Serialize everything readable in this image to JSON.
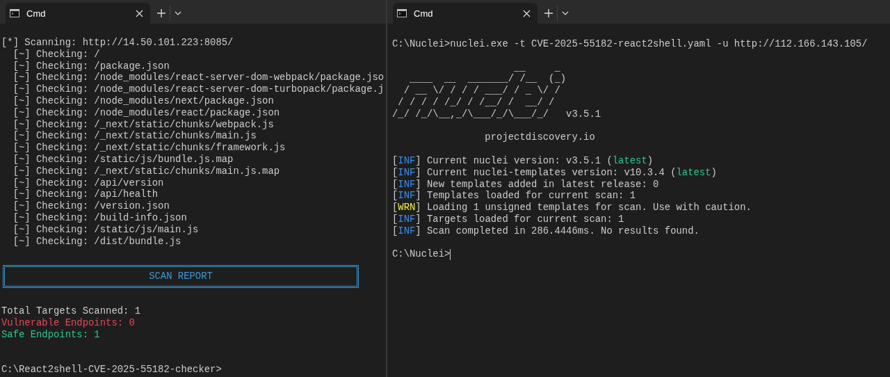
{
  "windows": [
    {
      "tab": {
        "title": "Cmd",
        "selected": true
      },
      "lines": [
        {
          "kind": "text",
          "segments": [
            {
              "text": "[*] Scanning: http://14.50.101.223:8085/"
            }
          ]
        },
        {
          "kind": "text",
          "segments": [
            {
              "text": "  [~] Checking: /"
            }
          ]
        },
        {
          "kind": "text",
          "segments": [
            {
              "text": "  [~] Checking: /package.json"
            }
          ]
        },
        {
          "kind": "text",
          "segments": [
            {
              "text": "  [~] Checking: /node_modules/react-server-dom-webpack/package.jso"
            }
          ]
        },
        {
          "kind": "text",
          "segments": [
            {
              "text": "  [~] Checking: /node_modules/react-server-dom-turbopack/package.j"
            }
          ]
        },
        {
          "kind": "text",
          "segments": [
            {
              "text": "  [~] Checking: /node_modules/next/package.json"
            }
          ]
        },
        {
          "kind": "text",
          "segments": [
            {
              "text": "  [~] Checking: /node_modules/react/package.json"
            }
          ]
        },
        {
          "kind": "text",
          "segments": [
            {
              "text": "  [~] Checking: /_next/static/chunks/webpack.js"
            }
          ]
        },
        {
          "kind": "text",
          "segments": [
            {
              "text": "  [~] Checking: /_next/static/chunks/main.js"
            }
          ]
        },
        {
          "kind": "text",
          "segments": [
            {
              "text": "  [~] Checking: /_next/static/chunks/framework.js"
            }
          ]
        },
        {
          "kind": "text",
          "segments": [
            {
              "text": "  [~] Checking: /static/js/bundle.js.map"
            }
          ]
        },
        {
          "kind": "text",
          "segments": [
            {
              "text": "  [~] Checking: /_next/static/chunks/main.js.map"
            }
          ]
        },
        {
          "kind": "text",
          "segments": [
            {
              "text": "  [~] Checking: /api/version"
            }
          ]
        },
        {
          "kind": "text",
          "segments": [
            {
              "text": "  [~] Checking: /api/health"
            }
          ]
        },
        {
          "kind": "text",
          "segments": [
            {
              "text": "  [~] Checking: /version.json"
            }
          ]
        },
        {
          "kind": "text",
          "segments": [
            {
              "text": "  [~] Checking: /build-info.json"
            }
          ]
        },
        {
          "kind": "text",
          "segments": [
            {
              "text": "  [~] Checking: /static/js/main.js"
            }
          ]
        },
        {
          "kind": "text",
          "segments": [
            {
              "text": "  [~] Checking: /dist/bundle.js"
            }
          ]
        },
        {
          "kind": "blank"
        },
        {
          "kind": "boxed",
          "text": "SCAN REPORT",
          "color": "#3a9ad9"
        },
        {
          "kind": "blank"
        },
        {
          "kind": "text",
          "segments": [
            {
              "text": "Total Targets Scanned: 1"
            }
          ]
        },
        {
          "kind": "text",
          "segments": [
            {
              "text": "Vulnerable Endpoints: 0",
              "color": "#e74856"
            }
          ]
        },
        {
          "kind": "text",
          "segments": [
            {
              "text": "Safe Endpoints: 1",
              "color": "#2ec98c"
            }
          ]
        },
        {
          "kind": "blank"
        },
        {
          "kind": "blank"
        },
        {
          "kind": "prompt",
          "text": "C:\\React2shell-CVE-2025-55182-checker>",
          "cursor": false
        }
      ]
    },
    {
      "tab": {
        "title": "Cmd",
        "selected": true
      },
      "lines": [
        {
          "kind": "text",
          "segments": [
            {
              "text": "C:\\Nuclei>nuclei.exe -t CVE-2025-55182-react2shell.yaml -u http://112.166.143.105/"
            }
          ]
        },
        {
          "kind": "blank"
        },
        {
          "kind": "banner",
          "text": "                     __     _"
        },
        {
          "kind": "banner",
          "text": "   ____  __  _______/ /__  (_)"
        },
        {
          "kind": "banner",
          "text": "  / __ \\/ / / / ___/ / _ \\/ /"
        },
        {
          "kind": "banner",
          "text": " / / / / /_/ / /__/ /  __/ /"
        },
        {
          "kind": "banner",
          "text": "/_/ /_/\\__,_/\\___/_/\\___/_/   v3.5.1"
        },
        {
          "kind": "blank"
        },
        {
          "kind": "text",
          "segments": [
            {
              "text": "                projectdiscovery.io"
            }
          ]
        },
        {
          "kind": "blank"
        },
        {
          "kind": "text",
          "segments": [
            {
              "text": "["
            },
            {
              "text": "INF",
              "color": "#3b8eea"
            },
            {
              "text": "] Current nuclei version: v3.5.1 ("
            },
            {
              "text": "latest",
              "color": "#2ec98c"
            },
            {
              "text": ")"
            }
          ]
        },
        {
          "kind": "text",
          "segments": [
            {
              "text": "["
            },
            {
              "text": "INF",
              "color": "#3b8eea"
            },
            {
              "text": "] Current nuclei-templates version: v10.3.4 ("
            },
            {
              "text": "latest",
              "color": "#2ec98c"
            },
            {
              "text": ")"
            }
          ]
        },
        {
          "kind": "text",
          "segments": [
            {
              "text": "["
            },
            {
              "text": "INF",
              "color": "#3b8eea"
            },
            {
              "text": "] New templates added in latest release: 0"
            }
          ]
        },
        {
          "kind": "text",
          "segments": [
            {
              "text": "["
            },
            {
              "text": "INF",
              "color": "#3b8eea"
            },
            {
              "text": "] Templates loaded for current scan: 1"
            }
          ]
        },
        {
          "kind": "text",
          "segments": [
            {
              "text": "["
            },
            {
              "text": "WRN",
              "color": "#f2f23a"
            },
            {
              "text": "] Loading 1 unsigned templates for scan. Use with caution."
            }
          ]
        },
        {
          "kind": "text",
          "segments": [
            {
              "text": "["
            },
            {
              "text": "INF",
              "color": "#3b8eea"
            },
            {
              "text": "] Targets loaded for current scan: 1"
            }
          ]
        },
        {
          "kind": "text",
          "segments": [
            {
              "text": "["
            },
            {
              "text": "INF",
              "color": "#3b8eea"
            },
            {
              "text": "] Scan completed in 286.4446ms. No results found."
            }
          ]
        },
        {
          "kind": "blank"
        },
        {
          "kind": "prompt",
          "text": "C:\\Nuclei>",
          "cursor": true
        }
      ]
    }
  ]
}
